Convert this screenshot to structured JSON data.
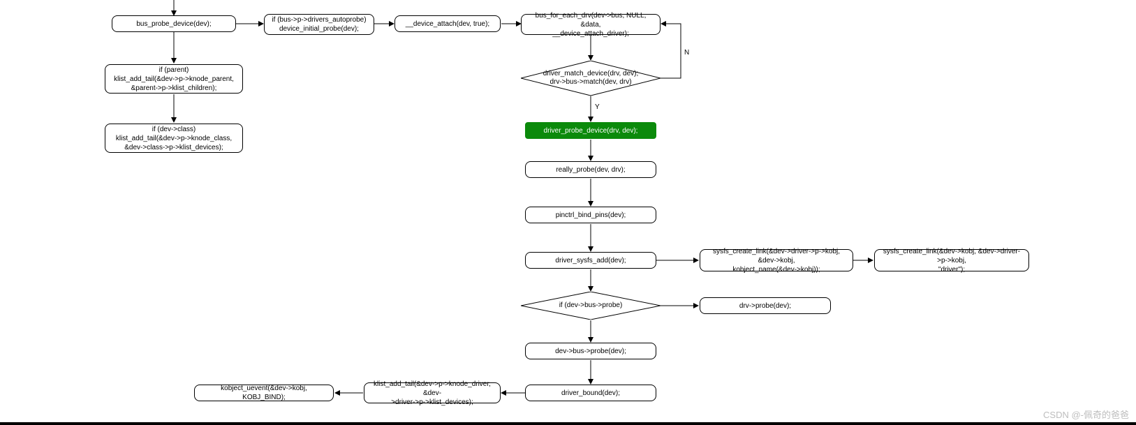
{
  "nodes": {
    "bus_probe": "bus_probe_device(dev);",
    "autoprobe": "if (bus->p->drivers_autoprobe)\ndevice_initial_probe(dev);",
    "device_attach": "__device_attach(dev, true);",
    "bus_for_each": "bus_for_each_drv(dev->bus, NULL, &data,\n__device_attach_driver);",
    "if_parent": "if (parent)\nklist_add_tail(&dev->p->knode_parent,\n&parent->p->klist_children);",
    "if_class": "if (dev->class)\nklist_add_tail(&dev->p->knode_class,\n&dev->class->p->klist_devices);",
    "driver_match": "driver_match_device(drv, dev);\ndrv->bus->match(dev, drv)",
    "driver_probe": "driver_probe_device(drv, dev);",
    "really_probe": "really_probe(dev, drv);",
    "pinctrl": "pinctrl_bind_pins(dev);",
    "sysfs_add": "driver_sysfs_add(dev);",
    "sysfs_link1": "sysfs_create_link(&dev->driver->p->kobj, &dev->kobj,\nkobject_name(&dev->kobj));",
    "sysfs_link2": "sysfs_create_link(&dev->kobj, &dev->driver->p->kobj,\n\"driver\");",
    "if_bus_probe": "if (dev->bus->probe)",
    "drv_probe": "drv->probe(dev);",
    "dev_bus_probe": "dev->bus->probe(dev);",
    "driver_bound": "driver_bound(dev);",
    "klist_add": "klist_add_tail(&dev->p->knode_driver, &dev-\n>driver->p->klist_devices);",
    "kobject_uevent": "kobject_uevent(&dev->kobj, KOBJ_BIND);"
  },
  "labels": {
    "yes": "Y",
    "no": "N"
  },
  "watermark": "CSDN @-佩奇的爸爸"
}
